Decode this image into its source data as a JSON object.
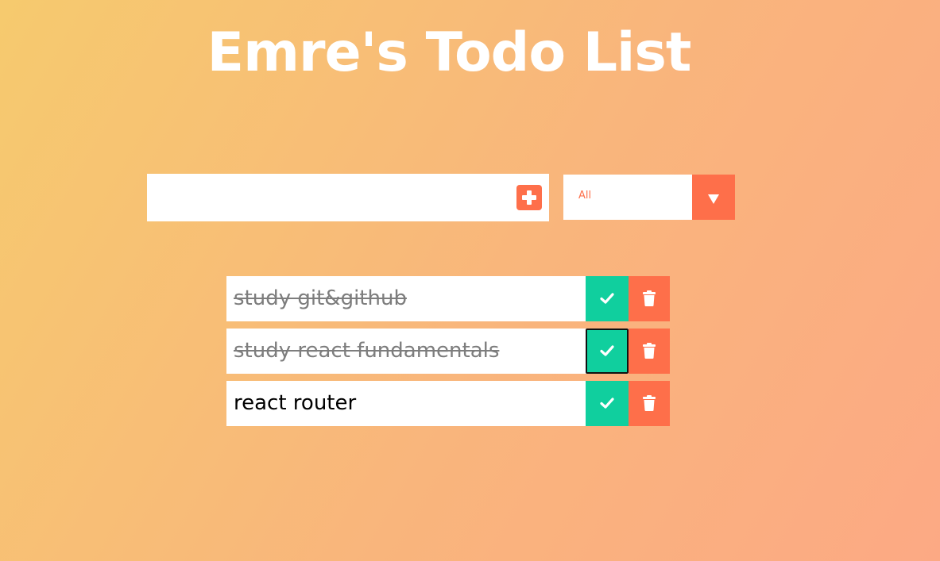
{
  "app": {
    "title": "Emre's Todo List"
  },
  "form": {
    "input_value": "",
    "input_placeholder": "",
    "add_icon": "plus-square-icon",
    "filter": {
      "selected": "All",
      "arrow_icon": "caret-down-icon"
    }
  },
  "todos": [
    {
      "text": "study git&github",
      "completed": true
    },
    {
      "text": "study react fundamentals",
      "completed": true
    },
    {
      "text": "react router",
      "completed": false
    }
  ],
  "icons": {
    "complete": "check-icon",
    "delete": "trash-icon"
  },
  "colors": {
    "accent": "#fe6f4a",
    "complete": "#10cf9e",
    "title": "#ffffff",
    "gradient_start": "#f6ca6e",
    "gradient_end": "#fca984"
  }
}
